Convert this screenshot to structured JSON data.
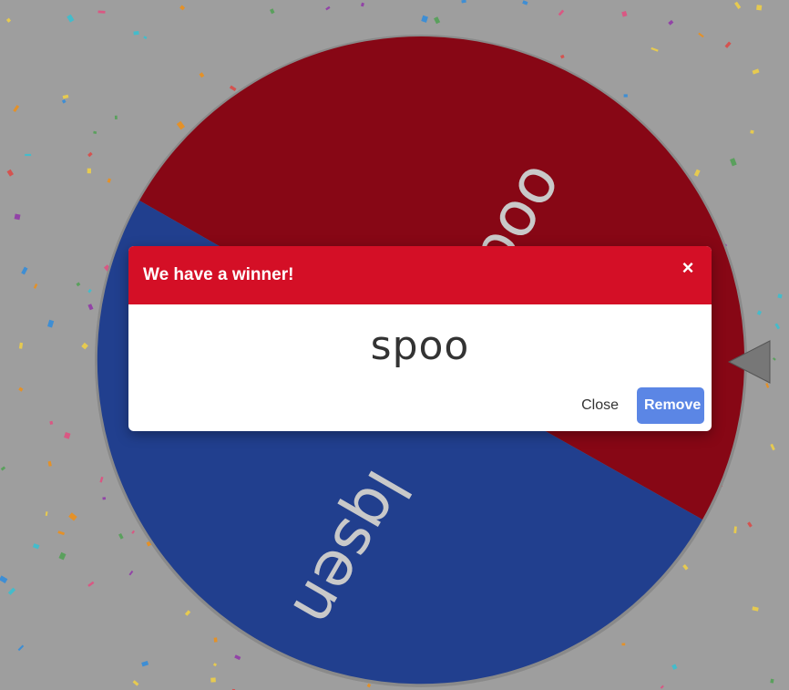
{
  "colors": {
    "background": "#9e9e9e",
    "wheel_red": "#870715",
    "wheel_blue": "#213f8e",
    "pointer": "#777777",
    "modal_header": "#d40f26",
    "remove_button": "#5b86e5",
    "wheel_text": "#c9c9c9"
  },
  "wheel": {
    "segments": [
      {
        "label": "spoo",
        "color": "#870715"
      },
      {
        "label": "lqsen",
        "color": "#213f8e"
      }
    ]
  },
  "pointer_icon": "triangle-left-icon",
  "modal": {
    "title": "We have a winner!",
    "close_symbol": "×",
    "winner": "spoo",
    "close_label": "Close",
    "remove_label": "Remove"
  }
}
